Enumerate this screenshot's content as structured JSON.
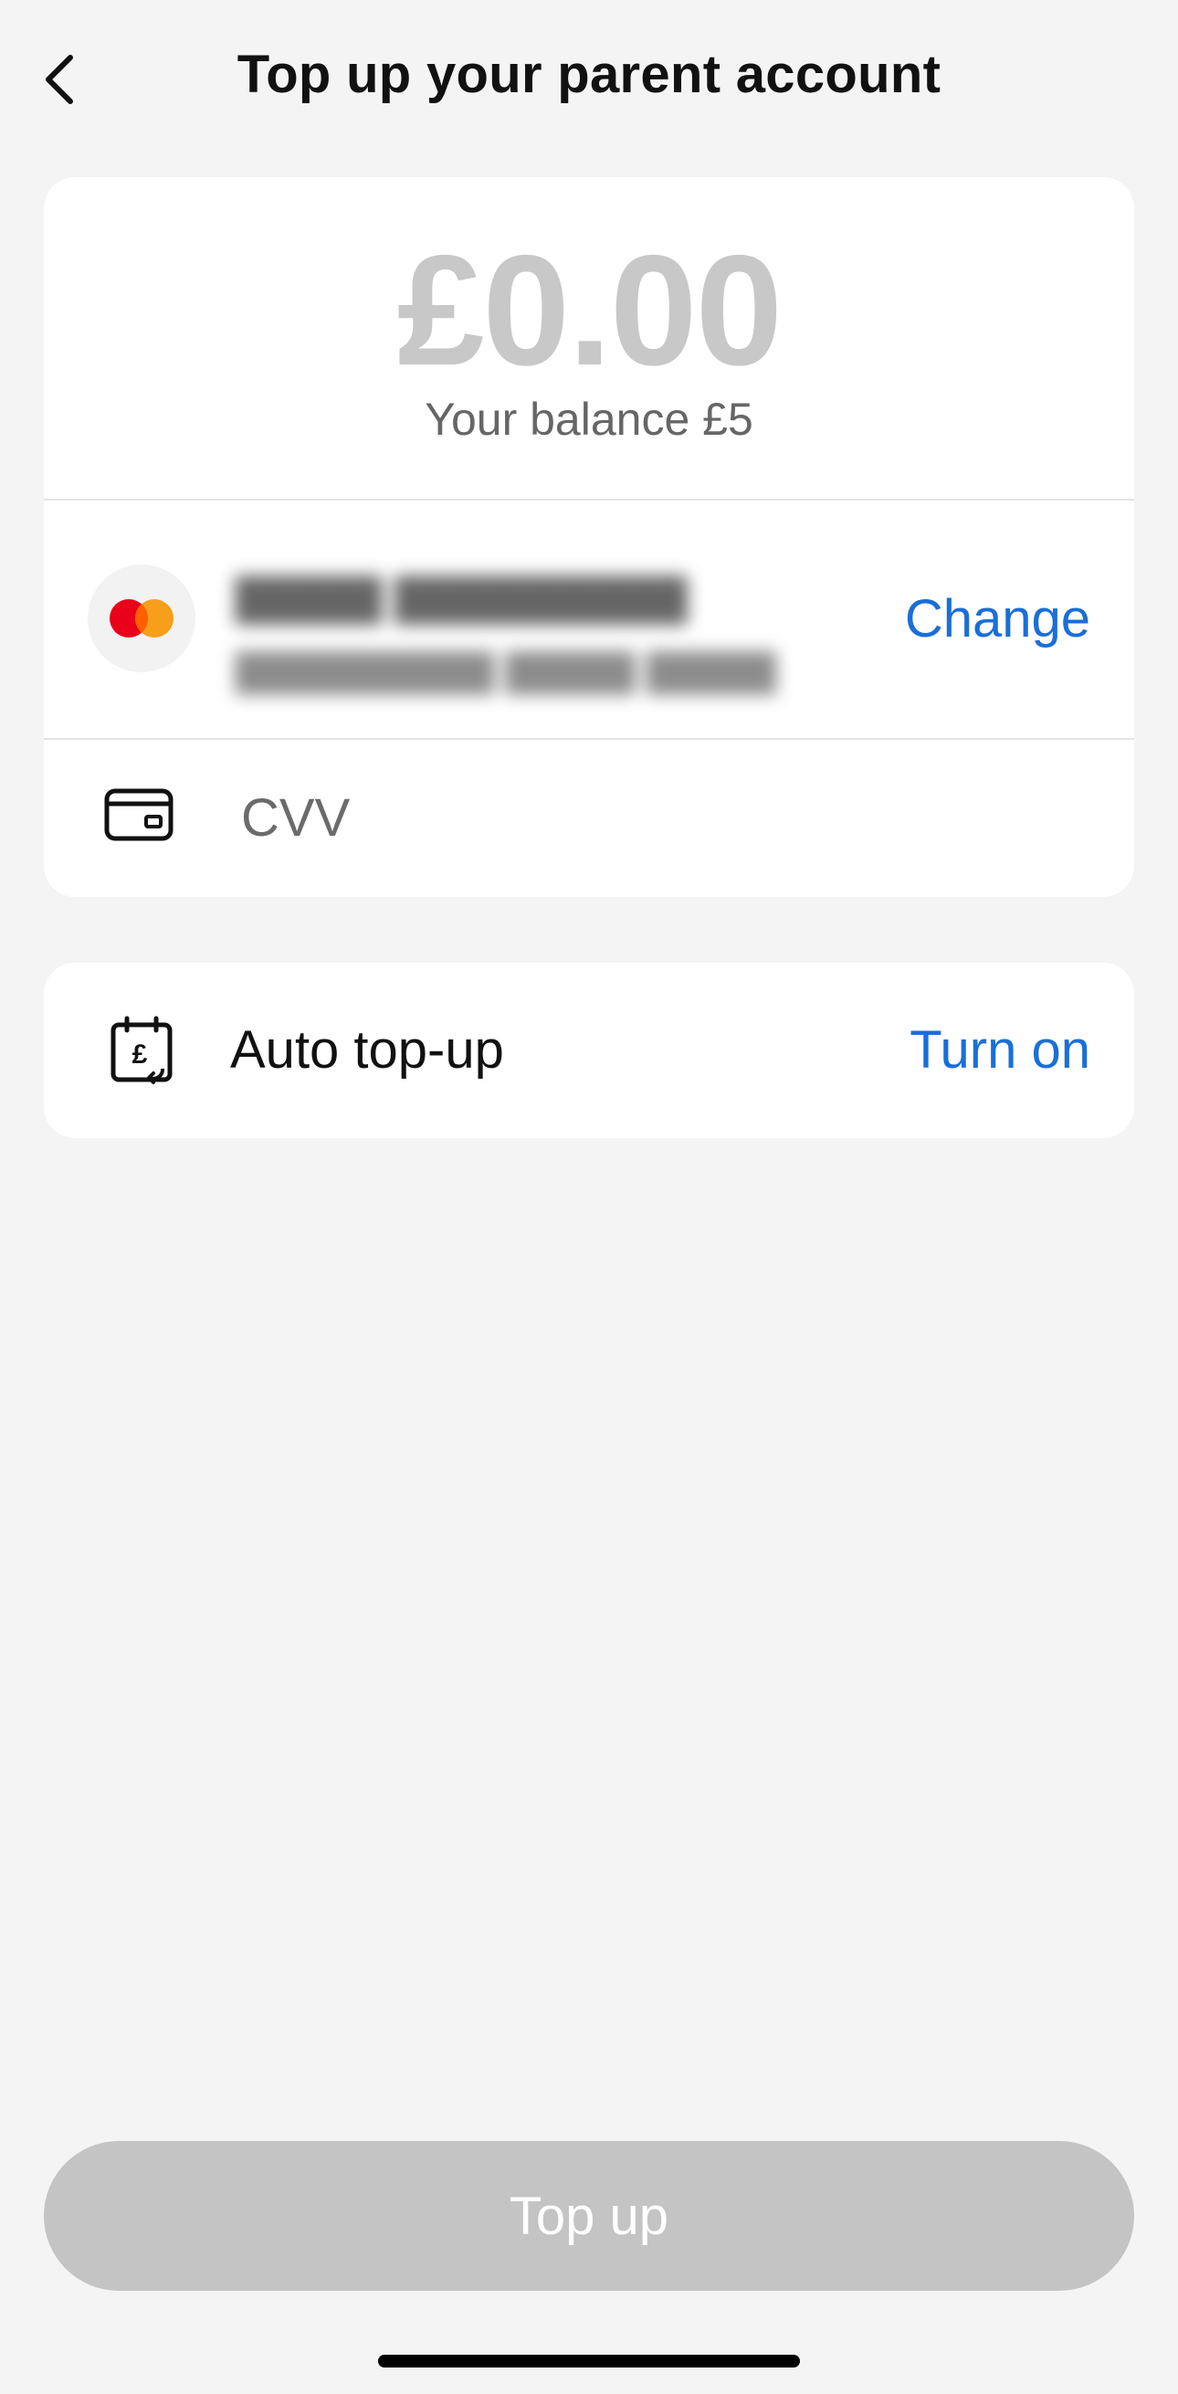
{
  "header": {
    "title": "Top up your parent account",
    "back_icon": "chevron-left-icon"
  },
  "amount": {
    "value": "£0.00",
    "balance_label": "Your balance £5"
  },
  "payment_card": {
    "brand_icon": "mastercard-icon",
    "change_label": "Change",
    "blurred": true
  },
  "cvv": {
    "placeholder": "CVV",
    "value": "",
    "icon": "card-icon"
  },
  "auto_topup": {
    "icon": "calendar-pound-icon",
    "label": "Auto top-up",
    "action_label": "Turn on"
  },
  "footer": {
    "topup_label": "Top up"
  },
  "colors": {
    "background": "#f4f4f4",
    "link": "#1a6fd8",
    "disabled_button": "#c4c4c4",
    "amount_placeholder": "#c8c8c8",
    "mastercard_red": "#eb001b",
    "mastercard_orange": "#f79e1b"
  }
}
